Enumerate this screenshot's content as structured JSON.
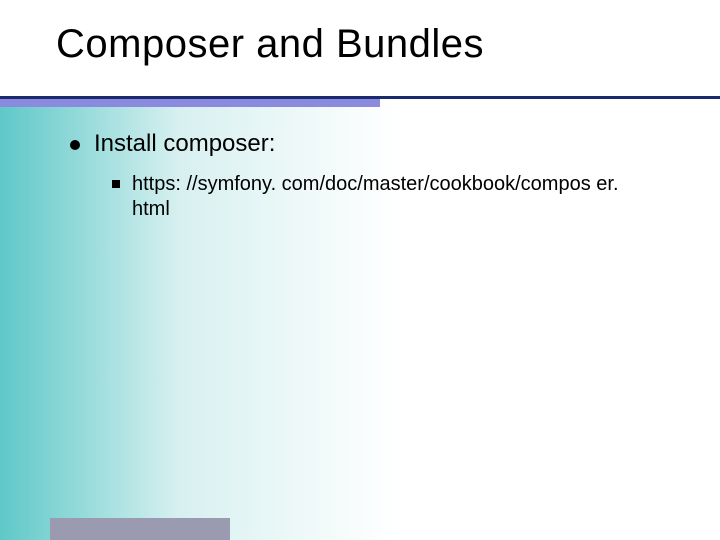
{
  "title": "Composer and Bundles",
  "content": {
    "lvl1_text": "Install composer:",
    "lvl2_text": "https: //symfony. com/doc/master/cookbook/compos er. html"
  }
}
